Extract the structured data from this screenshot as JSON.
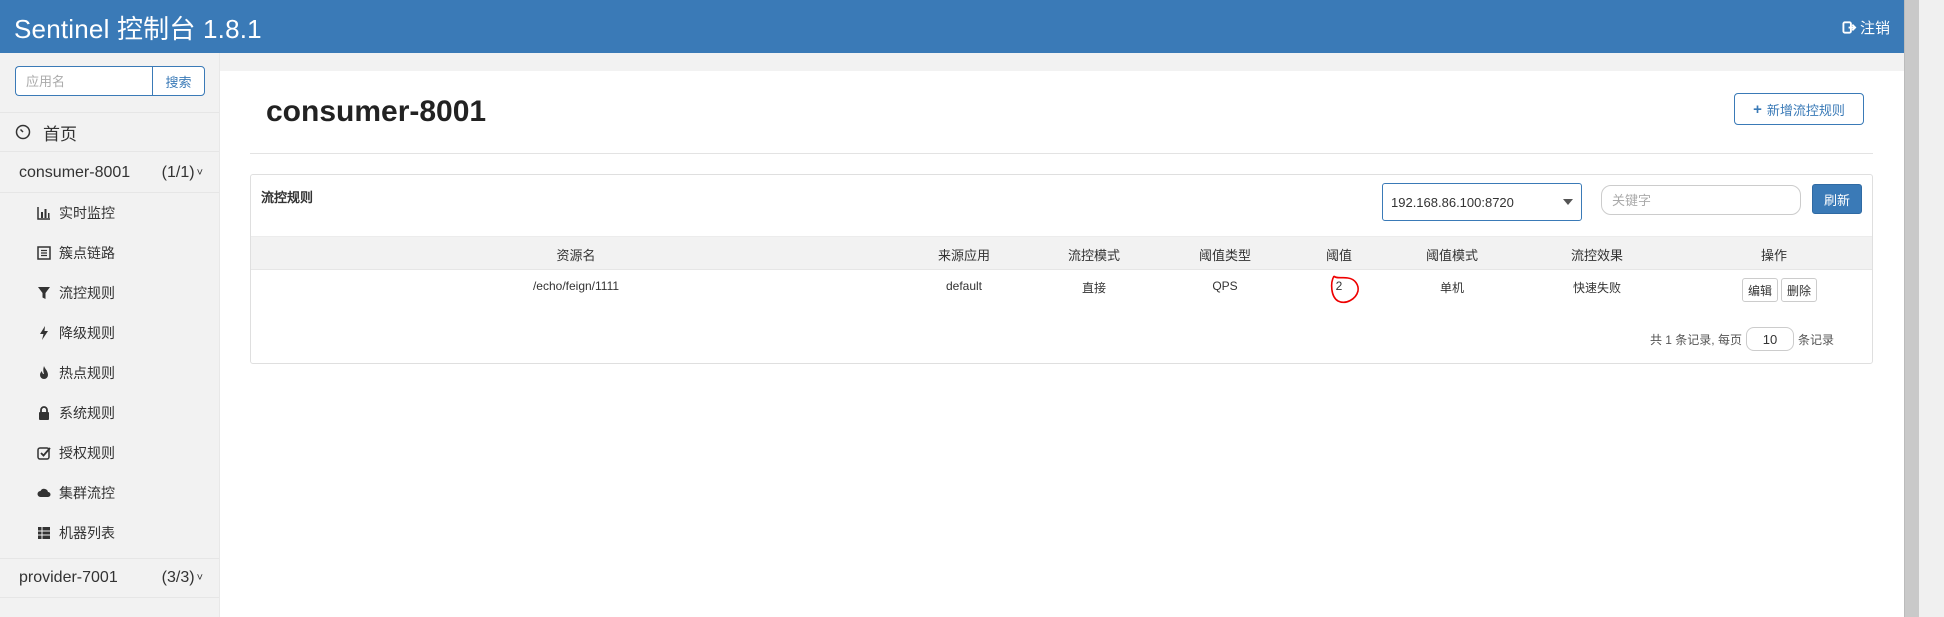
{
  "header": {
    "brand": "Sentinel 控制台 1.8.1",
    "logout_label": "注销",
    "bg_color": "#3a7ab7"
  },
  "sidebar": {
    "search_placeholder": "应用名",
    "search_button": "搜索",
    "home_label": "首页",
    "apps": [
      {
        "name": "consumer-8001",
        "count": "(1/1)",
        "chevron": "˅"
      },
      {
        "name": "provider-7001",
        "count": "(3/3)",
        "chevron": "˅"
      }
    ],
    "menu": [
      {
        "label": "实时监控",
        "icon": "bar-chart-icon"
      },
      {
        "label": "簇点链路",
        "icon": "list-icon"
      },
      {
        "label": "流控规则",
        "icon": "filter-icon"
      },
      {
        "label": "降级规则",
        "icon": "flash-icon"
      },
      {
        "label": "热点规则",
        "icon": "fire-icon"
      },
      {
        "label": "系统规则",
        "icon": "lock-icon"
      },
      {
        "label": "授权规则",
        "icon": "check-icon"
      },
      {
        "label": "集群流控",
        "icon": "cloud-icon"
      },
      {
        "label": "机器列表",
        "icon": "th-list-icon"
      }
    ]
  },
  "main": {
    "title": "consumer-8001",
    "add_button": "新增流控规则",
    "panel": {
      "title": "流控规则",
      "machine": "192.168.86.100:8720",
      "keyword_placeholder": "关键字",
      "refresh_button": "刷新",
      "columns": [
        "资源名",
        "来源应用",
        "流控模式",
        "阈值类型",
        "阈值",
        "阈值模式",
        "流控效果",
        "操作"
      ],
      "rows": [
        {
          "resource": "/echo/feign/1111",
          "limit_app": "default",
          "strategy": "直接",
          "grade": "QPS",
          "count": "2",
          "cluster_mode": "单机",
          "behavior": "快速失败"
        }
      ],
      "edit_button": "编辑",
      "delete_button": "删除",
      "pager_prefix": "共 1 条记录, 每页",
      "page_size": "10",
      "pager_suffix": "条记录"
    }
  }
}
